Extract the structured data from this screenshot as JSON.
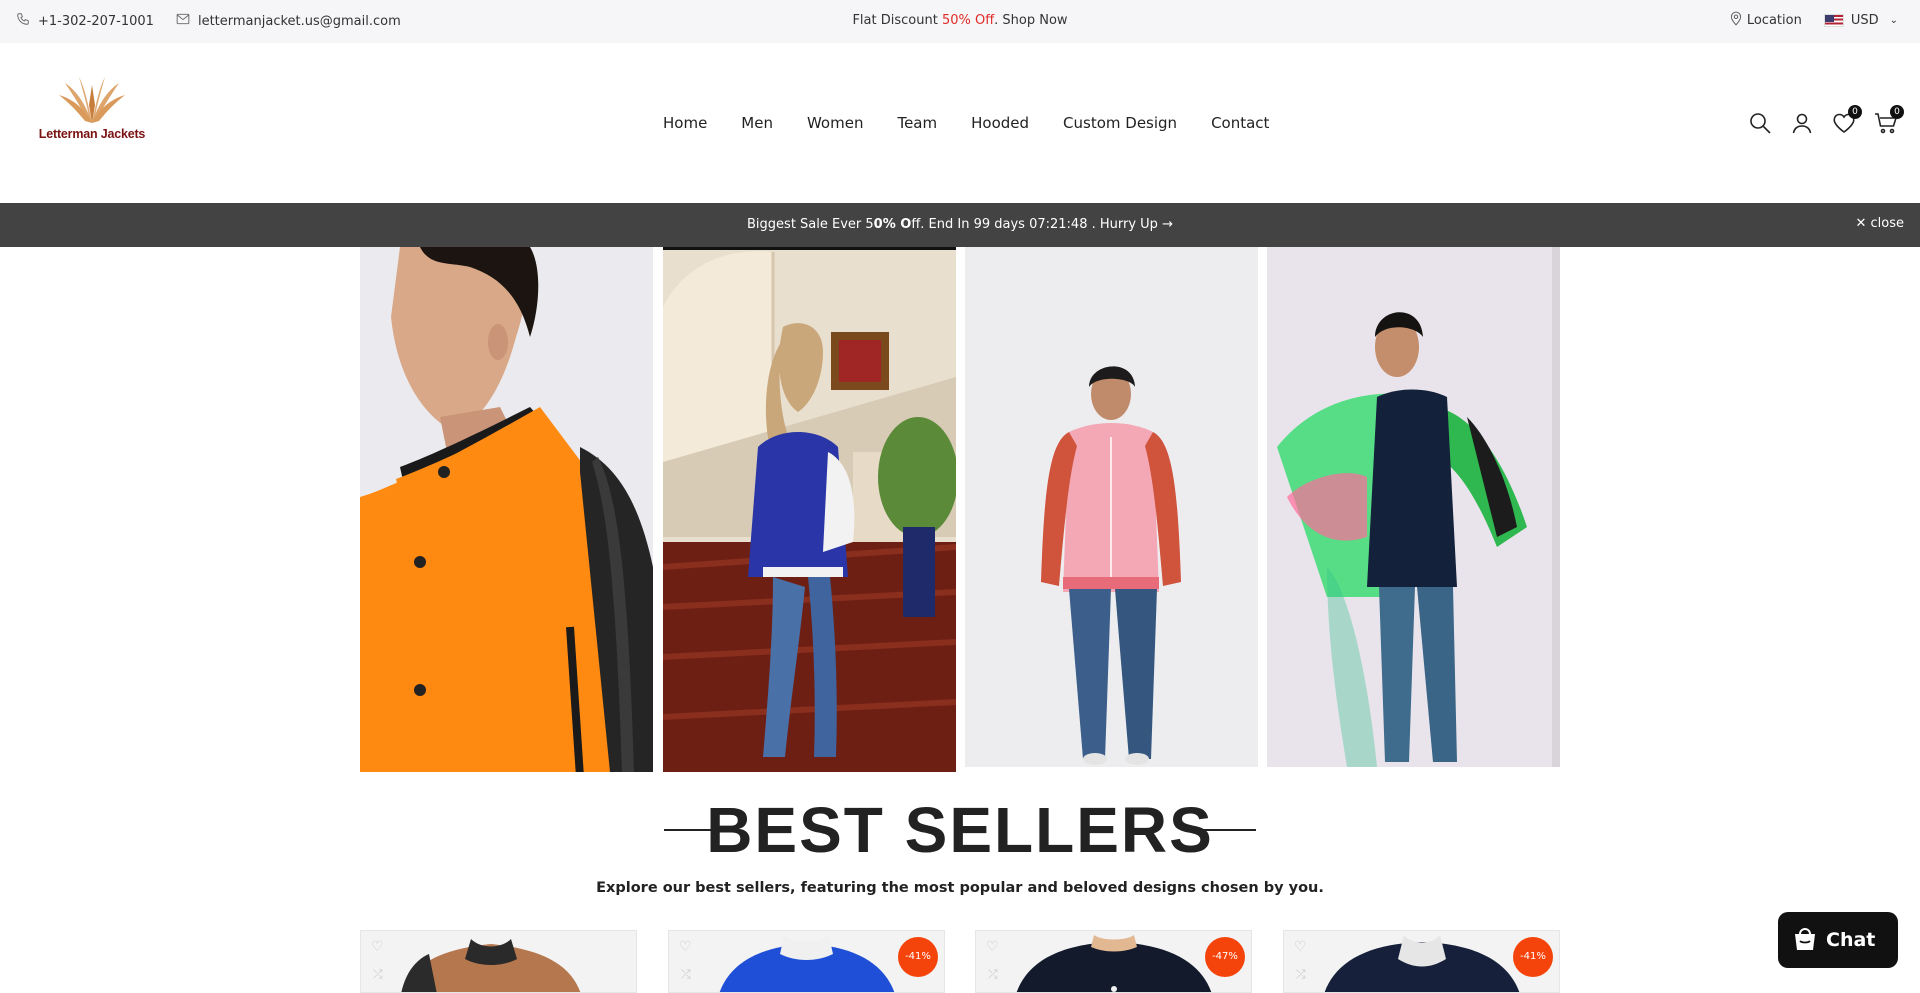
{
  "topbar": {
    "phone": "+1-302-207-1001",
    "email": "lettermanjacket.us@gmail.com",
    "promo_prefix": "Flat Discount ",
    "promo_highlight": "50% Of",
    "promo_suffix": "f. Shop Now",
    "location": "Location",
    "currency": "USD"
  },
  "header": {
    "logo_text": "Letterman Jackets",
    "nav": [
      "Home",
      "Men",
      "Women",
      "Team",
      "Hooded",
      "Custom Design",
      "Contact"
    ],
    "wishlist_count": "0",
    "cart_count": "0"
  },
  "salebar": {
    "prefix": "Biggest Sale Ever 5",
    "bold": "0% O",
    "suffix": "ff. End In 99 days 07:21:48 .  Hurry Up →",
    "close": "close"
  },
  "bestsellers": {
    "title": "BEST SELLERS",
    "subtitle": "Explore our best sellers, featuring the most popular and beloved designs chosen by you.",
    "badges": [
      "",
      "-41%",
      "-47%",
      "-41%"
    ]
  },
  "chat": {
    "label": "Chat"
  },
  "colors": {
    "accent_red": "#e02b27",
    "sale_badge": "#f5440b",
    "salebar_bg": "#434343"
  }
}
